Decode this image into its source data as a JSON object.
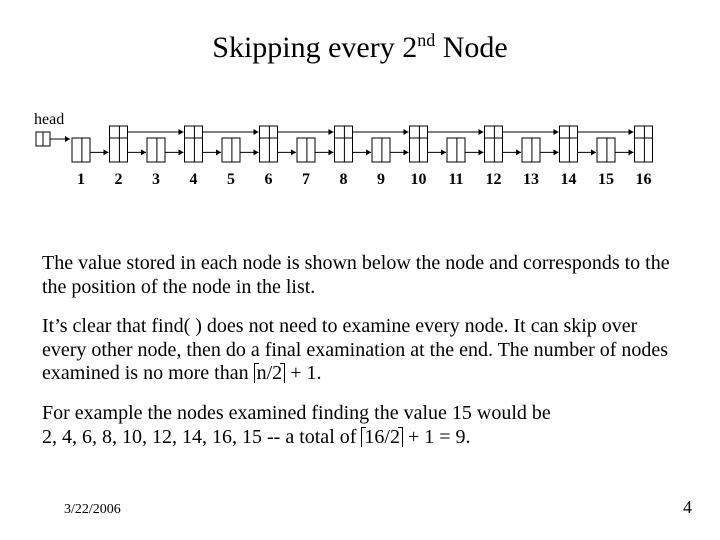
{
  "title": {
    "prefix": "Skipping every 2",
    "sup": "nd",
    "suffix": " Node"
  },
  "diagram": {
    "head_label": "head",
    "node_labels": [
      "1",
      "2",
      "3",
      "4",
      "5",
      "6",
      "7",
      "8",
      "9",
      "10",
      "11",
      "12",
      "13",
      "14",
      "15",
      "16"
    ]
  },
  "paragraphs": {
    "p1": "The value stored in each node is shown below the node and corresponds to the the position of the node in the list.",
    "p2a": "It’s clear that find( ) does not need to examine every node.  It can skip over every other node, then do a final examination at the end.  The number of nodes examined is no more than ",
    "p2_ceil": "n/2",
    "p2b": " + 1.",
    "p3a": "For example the nodes examined finding the value 15 would be",
    "p3b": " 2, 4, 6, 8, 10, 12, 14, 16, 15 -- a total of ",
    "p3_ceil": "16/2",
    "p3c": " + 1 = 9."
  },
  "footer": {
    "date": "3/22/2006",
    "page": "4"
  }
}
